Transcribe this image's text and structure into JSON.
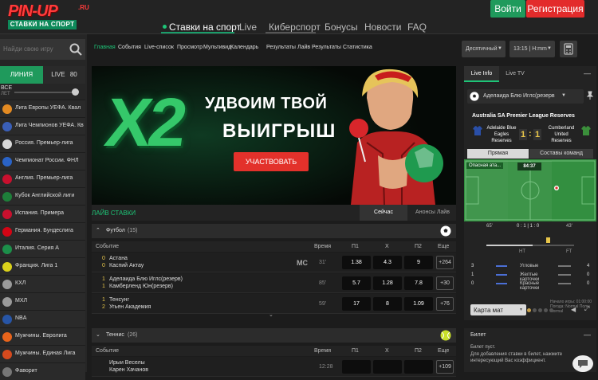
{
  "header": {
    "logo_brand": "PIN-UP",
    "logo_domain": ".RU",
    "logo_tagline": "СТАВКИ НА СПОРТ",
    "nav": [
      "Ставки на спорт",
      "Live",
      "Киберспорт",
      "Бонусы",
      "Новости",
      "FAQ"
    ],
    "login_label": "Войти",
    "register_label": "Регистрация"
  },
  "sidebar": {
    "search_placeholder": "Найди свою игру",
    "tab_line": "ЛИНИЯ",
    "tab_live": "LIVE",
    "live_count": "80",
    "all_label": "ВСЕ",
    "period_label": "ЛЕТ",
    "items": [
      {
        "label": "Лига Европы УЕФА. Квал",
        "color": "#e38a22"
      },
      {
        "label": "Лига Чемпионов УЕФА. Кв",
        "color": "#3a5fb8"
      },
      {
        "label": "Россия. Премьер-лига",
        "color": "#d9d9d9"
      },
      {
        "label": "Чемпионат России. ФНЛ",
        "color": "#2a63c6"
      },
      {
        "label": "Англия. Премьер-лига",
        "color": "#c8102e"
      },
      {
        "label": "Кубок Английской лиги",
        "color": "#1e7f3a"
      },
      {
        "label": "Испания. Примера",
        "color": "#c8102e"
      },
      {
        "label": "Германия. Бундеслига",
        "color": "#d20515"
      },
      {
        "label": "Италия. Серия А",
        "color": "#1c8f4a"
      },
      {
        "label": "Франция. Лига 1",
        "color": "#dad11b"
      },
      {
        "label": "КХЛ",
        "color": "#9a9a9a"
      },
      {
        "label": "МХЛ",
        "color": "#9a9a9a"
      },
      {
        "label": "NBA",
        "color": "#2755a6"
      },
      {
        "label": "Мужчины. Евролига",
        "color": "#e8641b"
      },
      {
        "label": "Мужчины. Единая Лига",
        "color": "#d64a1e"
      },
      {
        "label": "Фаворит",
        "color": "#777777"
      }
    ]
  },
  "subnav": {
    "items": [
      "Главная",
      "События",
      "Live-список",
      "Просмотр",
      "Мультивид",
      "Календарь",
      "Результаты",
      "Лайв Результаты",
      "Статистика"
    ],
    "odds_format": "Десятичный",
    "time": "13:15 | H:mm"
  },
  "banner": {
    "multiplier": "X2",
    "headline_1": "УДВОИМ ТВОЙ",
    "headline_2": "ВЫИГРЫШ",
    "cta": "УЧАСТВОВАТЬ"
  },
  "live": {
    "title": "ЛАЙВ СТАВКИ",
    "tab_now": "Сейчас",
    "tab_announce": "Анонсы Лайв",
    "col_event": "Событие",
    "col_time": "Время",
    "col_p1": "П1",
    "col_x": "Х",
    "col_p2": "П2",
    "col_more": "Еще",
    "football_label": "Футбол",
    "football_count": "(15)",
    "tennis_label": "Теннис",
    "tennis_count": "(26)",
    "football_rows": [
      {
        "n1": "0",
        "n2": "0",
        "t1": "Астана",
        "t2": "Каспий Актау",
        "badge": "МС",
        "time": "31'",
        "p1": "1.38",
        "x": "4.3",
        "p2": "9",
        "more": "+264"
      },
      {
        "n1": "1",
        "n2": "1",
        "t1": "Аделаида Блю Иглс(резерв)",
        "t2": "Камберленд Юн(резерв)",
        "badge": "",
        "time": "85'",
        "p1": "5.7",
        "x": "1.28",
        "p2": "7.8",
        "more": "+30"
      },
      {
        "n1": "1",
        "n2": "2",
        "t1": "Тенсунг",
        "t2": "Угьен Академия",
        "badge": "",
        "time": "59'",
        "p1": "17",
        "x": "8",
        "p2": "1.09",
        "more": "+76"
      }
    ],
    "tennis_rows": [
      {
        "n1": "",
        "n2": "",
        "t1": "Ирыи Веселы",
        "t2": "Карен Хачанов",
        "badge": "",
        "time": "12:28",
        "p1": "",
        "x": "",
        "p2": "",
        "more": "+109"
      }
    ]
  },
  "right_panel": {
    "tab_live_info": "Live Info",
    "tab_live_tv": "Live TV",
    "match_select": "Аделаида Блю Иглс(резерв",
    "league": "Australia SA Premier League Reserves",
    "home_team": "Adelaide Blue Eagles Reserves",
    "away_team": "Cumberland United Reserves",
    "score_home": "1",
    "score_away": "1",
    "sub_tab_direct": "Прямая",
    "sub_tab_lineups": "Составы команд",
    "event_label": "Опасная ата...",
    "clock": "84:37",
    "minute_home": "65'",
    "minute_away": "43'",
    "timeline": "0 : 1 | 1 : 0",
    "ht": "HT",
    "ft": "FT",
    "stats": [
      {
        "home": "3",
        "label": "Угловые",
        "away": "4"
      },
      {
        "home": "1",
        "label": "Желтые карточки",
        "away": "0"
      },
      {
        "home": "0",
        "label": "Красные карточки",
        "away": "0"
      }
    ],
    "stats_note": "Начало игры: 01:00:00 Погода: Normal Поле: Normal",
    "map_label": "Карта мат",
    "betslip_title": "Билет",
    "betslip_empty": "Билет пуст.",
    "betslip_hint": "Для добавления ставки в билет, нажмите интересующий Вас коэффициент."
  }
}
